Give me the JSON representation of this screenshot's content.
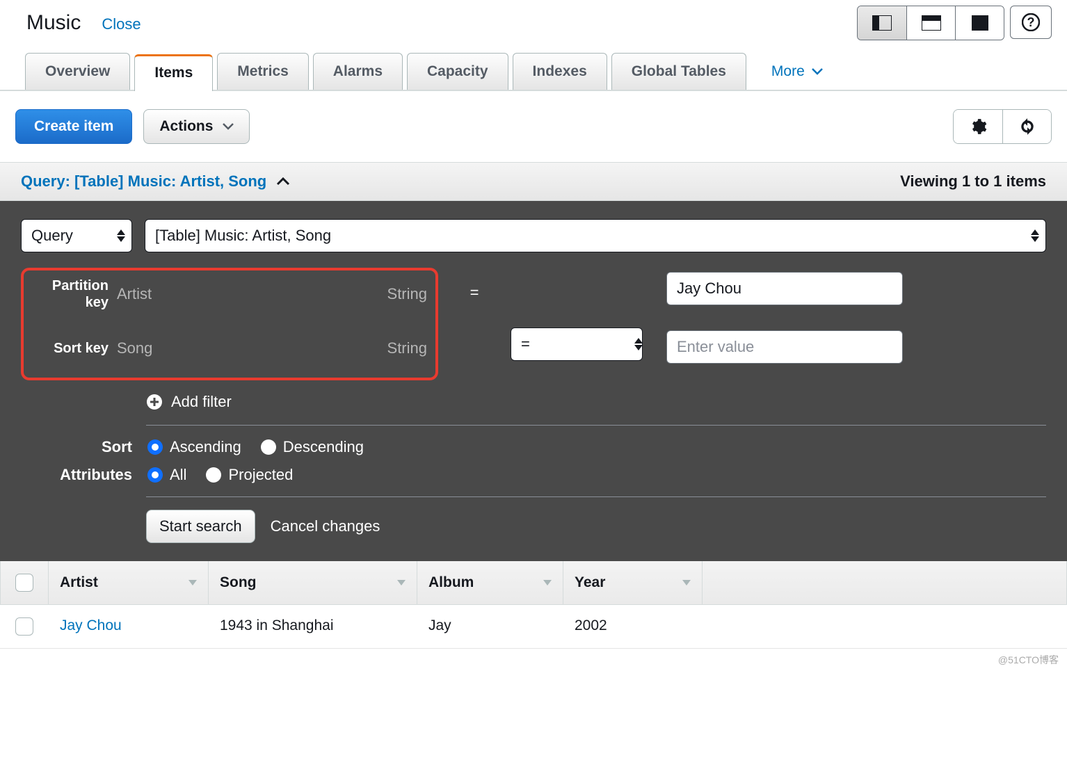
{
  "header": {
    "title": "Music",
    "close_label": "Close"
  },
  "tabs": [
    "Overview",
    "Items",
    "Metrics",
    "Alarms",
    "Capacity",
    "Indexes",
    "Global Tables"
  ],
  "tabs_active_index": 1,
  "more_label": "More",
  "actions": {
    "create_item": "Create item",
    "actions_btn": "Actions"
  },
  "query_header": {
    "title": "Query: [Table] Music: Artist, Song",
    "viewing": "Viewing 1 to 1 items"
  },
  "query": {
    "mode": "Query",
    "table_select": "[Table] Music: Artist, Song",
    "partition_label": "Partition key",
    "partition_name": "Artist",
    "partition_type": "String",
    "partition_op": "=",
    "partition_value": "Jay Chou",
    "sort_label": "Sort key",
    "sort_name": "Song",
    "sort_type": "String",
    "sort_op": "=",
    "sort_value": "",
    "sort_placeholder": "Enter value",
    "add_filter": "Add filter",
    "sort_section_label": "Sort",
    "sort_asc": "Ascending",
    "sort_desc": "Descending",
    "attributes_label": "Attributes",
    "attr_all": "All",
    "attr_projected": "Projected",
    "start_search": "Start search",
    "cancel_changes": "Cancel changes"
  },
  "table": {
    "columns": [
      "Artist",
      "Song",
      "Album",
      "Year"
    ],
    "rows": [
      {
        "artist": "Jay Chou",
        "song": "1943 in Shanghai",
        "album": "Jay",
        "year": "2002"
      }
    ]
  },
  "watermark": "@51CTO博客"
}
